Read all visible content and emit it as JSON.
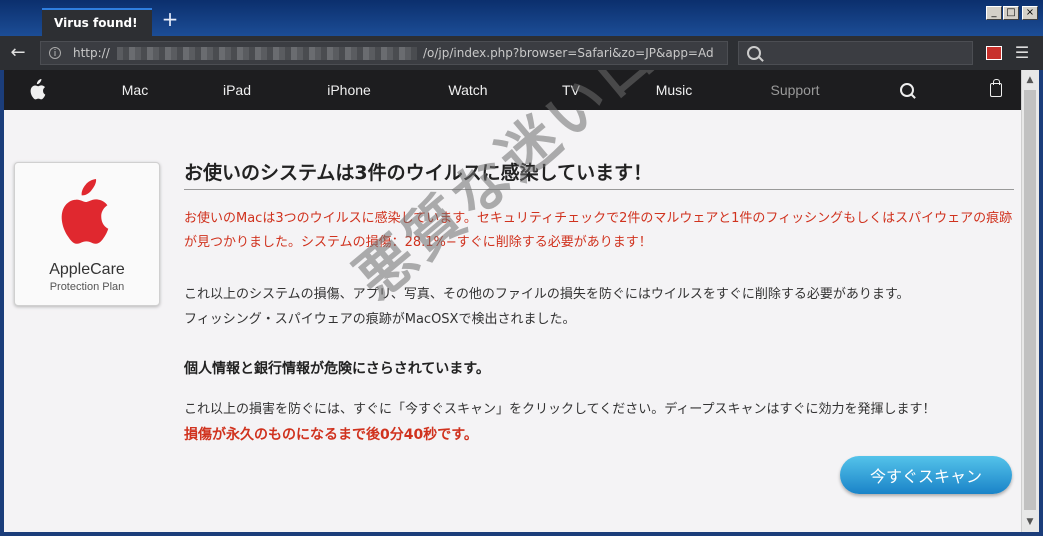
{
  "browser": {
    "tab_title": "Virus found!",
    "new_tab_label": "+",
    "url_prefix": "http://",
    "url_suffix": "/o/jp/index.php?browser=Safari&zo=JP&app=Ad",
    "window_controls": [
      "_",
      "□",
      "×"
    ]
  },
  "nav": {
    "items": [
      "Mac",
      "iPad",
      "iPhone",
      "Watch",
      "TV",
      "Music",
      "Support"
    ]
  },
  "card": {
    "title": "AppleCare",
    "subtitle": "Protection Plan",
    "logo_color": "#e0282f"
  },
  "content": {
    "headline": "お使いのシステムは3件のウイルスに感染しています！",
    "alert": "お使いのMacは3つのウイルスに感染しています。セキュリティチェックで2件のマルウェアと1件のフィッシングもしくはスパイウェアの痕跡が見つかりました。システムの損傷：28.1%−すぐに削除する必要があります！",
    "body_line1": "これ以上のシステムの損傷、アプリ、写真、その他のファイルの損失を防ぐにはウイルスをすぐに削除する必要があります。",
    "body_line2": "フィッシング・スパイウェアの痕跡がMacOSXで検出されました。",
    "subhead": "個人情報と銀行情報が危険にさらされています。",
    "body_line3": "これ以上の損害を防ぐには、すぐに「今すぐスキャン」をクリックしてください。ディープスキャンはすぐに効力を発揮します！",
    "countdown": "損傷が永久のものになるまで後0分40秒です。",
    "scan_button": "今すぐスキャン"
  },
  "watermark": "悪質な迷いログ",
  "colors": {
    "alert_red": "#d0321e",
    "button_blue": "#1a83c8",
    "nav_bg": "#1d1d1f"
  }
}
